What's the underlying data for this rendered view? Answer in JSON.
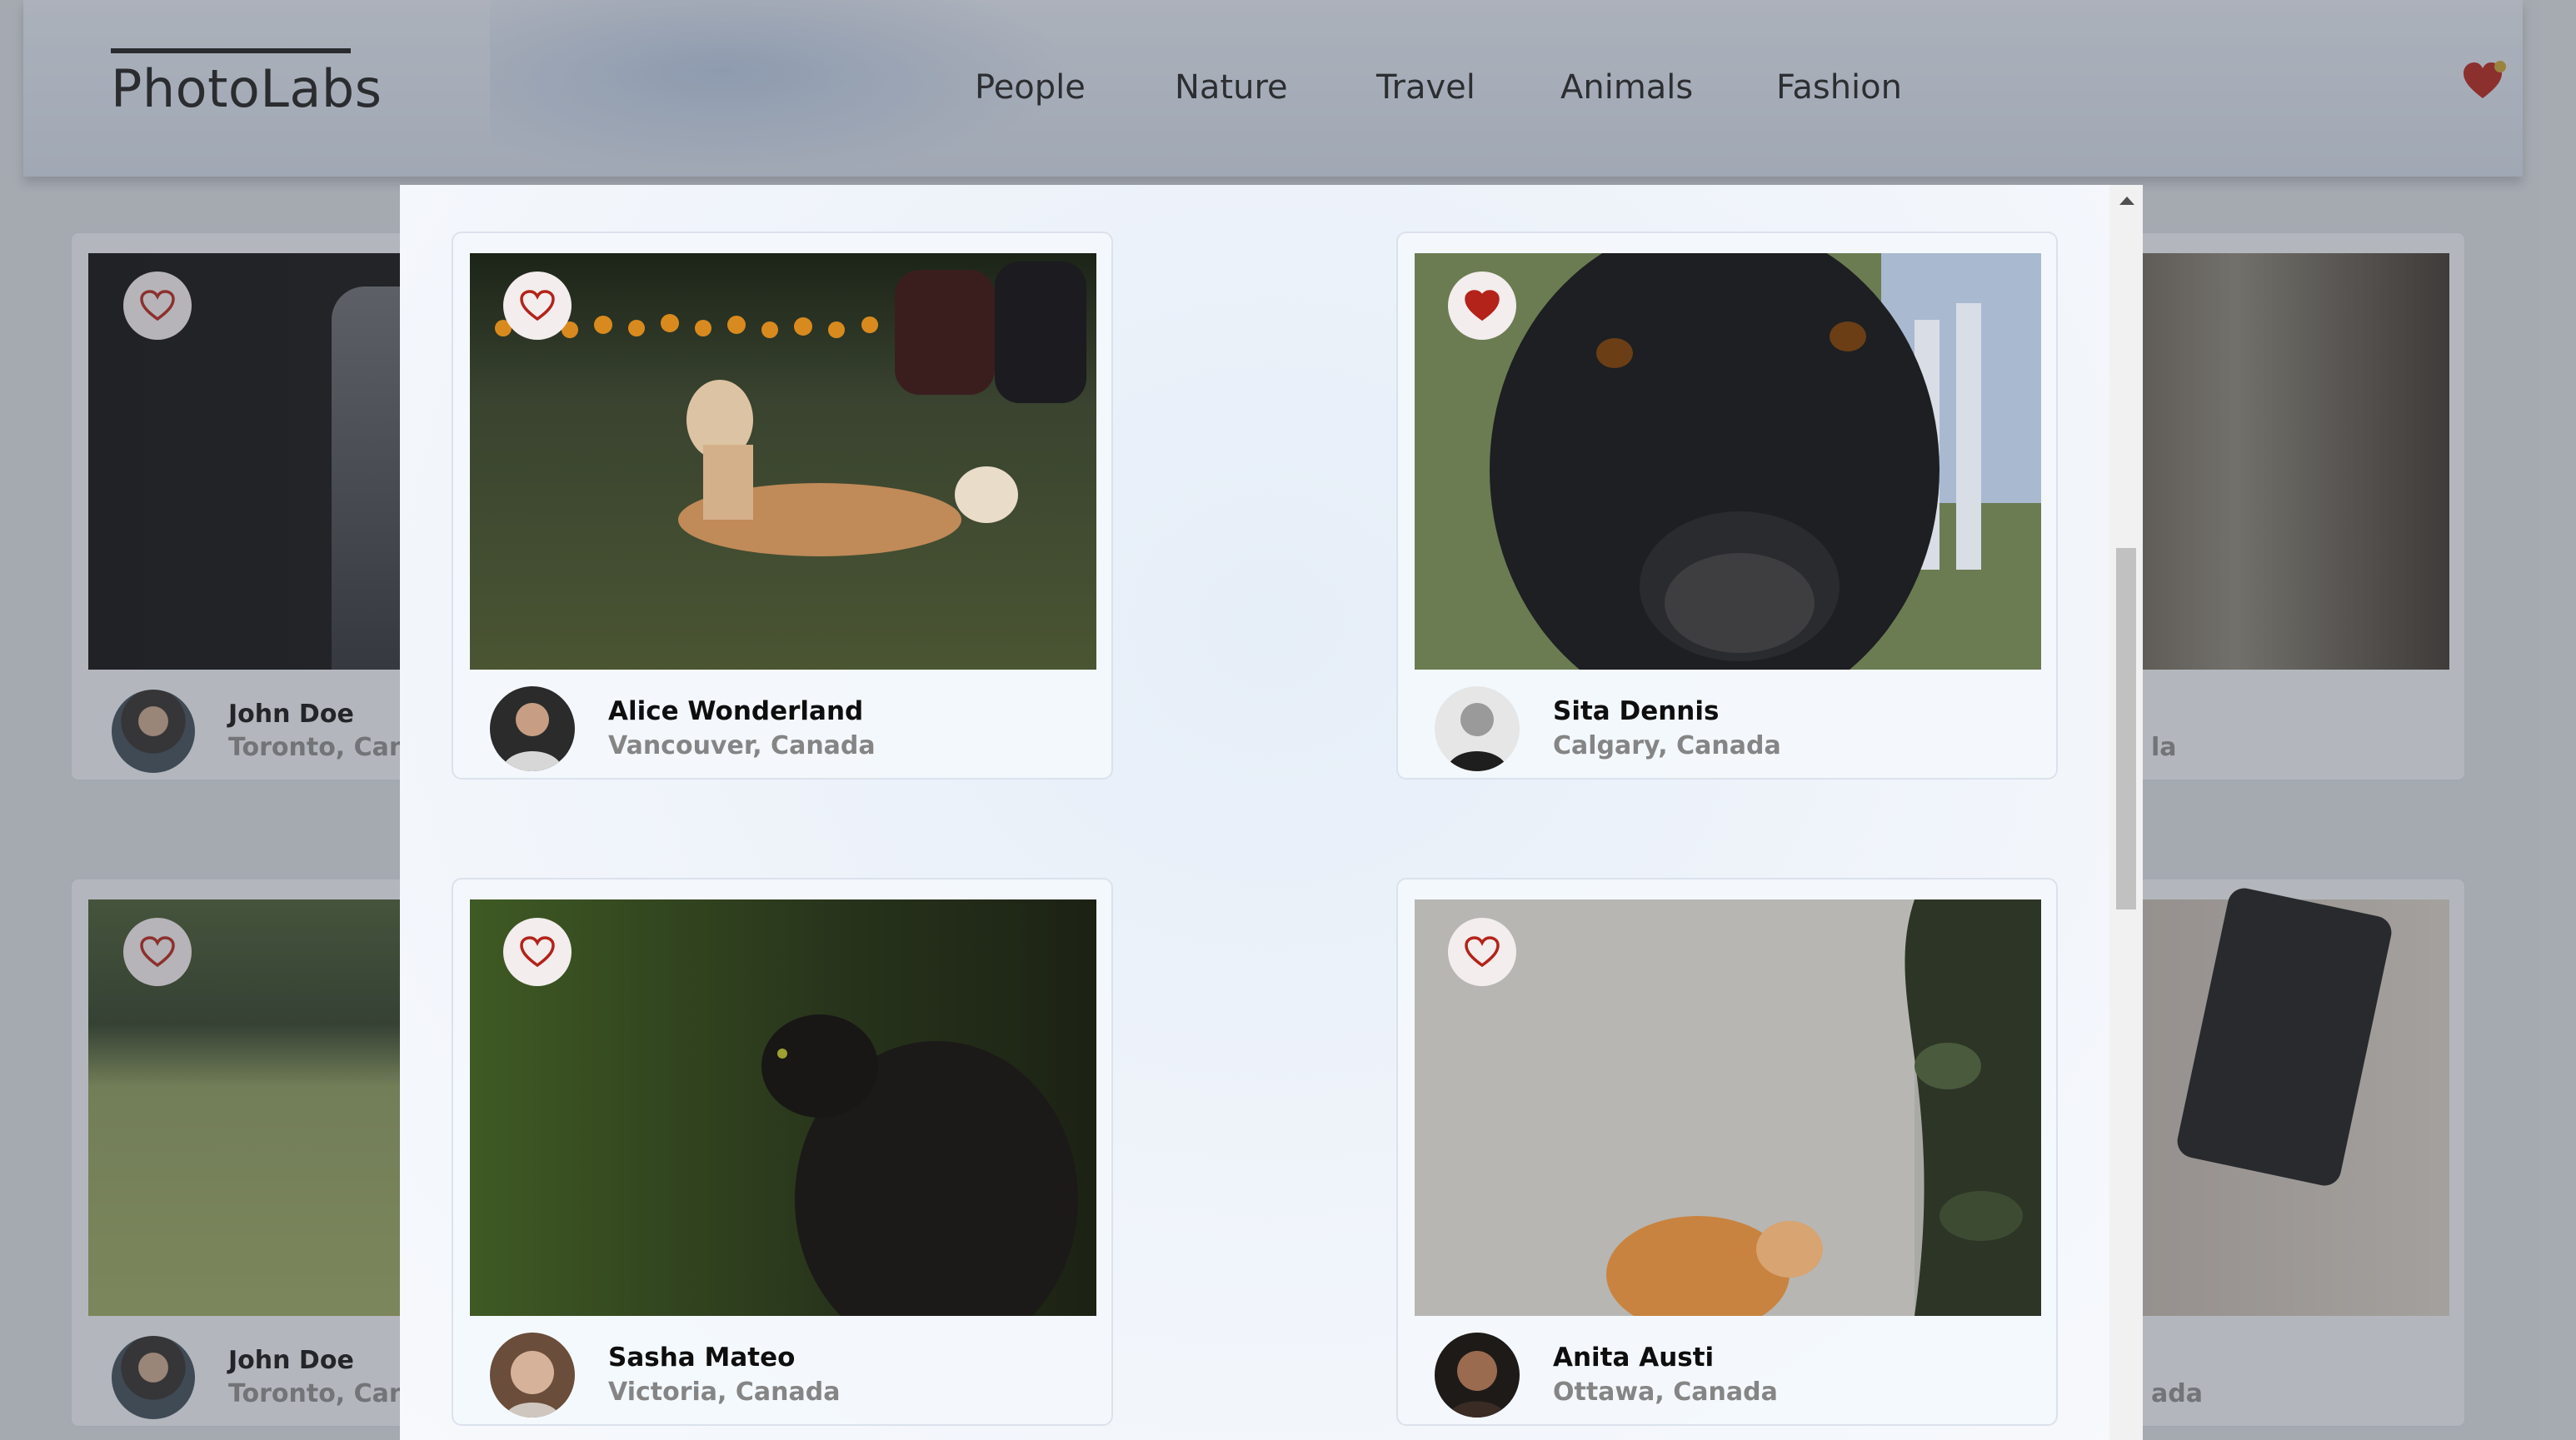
{
  "app": {
    "logo": "PhotoLabs"
  },
  "topics": [
    "People",
    "Nature",
    "Travel",
    "Animals",
    "Fashion"
  ],
  "colors": {
    "heart": "#b3231a",
    "heart_badge": "#c8a233"
  },
  "background_cards": [
    {
      "name": "John Doe",
      "location": "Toronto, Canada"
    },
    {
      "name": "John Doe",
      "location": "Toronto, Canada"
    },
    {
      "location_suffix": "la"
    },
    {
      "location_suffix": "ada"
    }
  ],
  "modal": {
    "photos": [
      {
        "name": "Alice Wonderland",
        "location": "Vancouver, Canada",
        "favourited": false,
        "icon": "heart-outline-icon"
      },
      {
        "name": "Sita Dennis",
        "location": "Calgary, Canada",
        "favourited": true,
        "icon": "heart-filled-icon"
      },
      {
        "name": "Sasha Mateo",
        "location": "Victoria, Canada",
        "favourited": false,
        "icon": "heart-outline-icon"
      },
      {
        "name": "Anita Austi",
        "location": "Ottawa, Canada",
        "favourited": false,
        "icon": "heart-outline-icon"
      }
    ]
  }
}
